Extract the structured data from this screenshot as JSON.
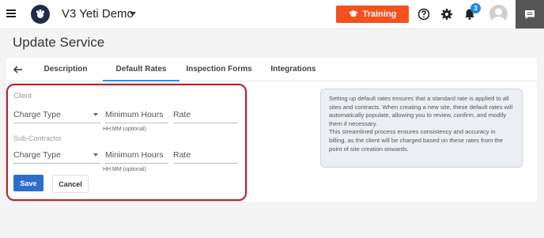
{
  "header": {
    "app_title": "V3 Yeti Demo",
    "training_label": "Training",
    "notification_count": "3",
    "icons": {
      "menu": "hamburger-menu-icon",
      "logo": "logo-icon",
      "training": "graduation-cap-icon",
      "help": "help-icon",
      "settings": "gear-icon",
      "notifications": "bell-icon",
      "avatar": "user-avatar",
      "chat": "chat-icon"
    },
    "colors": {
      "training": "#f4511e",
      "badge": "#1e88e5",
      "chat": "#555555"
    }
  },
  "page": {
    "title": "Update Service"
  },
  "tabs": {
    "items": [
      {
        "label": "Description"
      },
      {
        "label": "Default Rates"
      },
      {
        "label": "Inspection Forms"
      },
      {
        "label": "Integrations"
      }
    ],
    "active": "Default Rates"
  },
  "form": {
    "client_label": "Client",
    "subcontractor_label": "Sub-Contractor",
    "client_row": {
      "charge_type": "Charge Type",
      "minimum_hours": "Minimum Hours",
      "rate": "Rate",
      "hint": "HH:MM (optional)"
    },
    "subcontractor_row": {
      "charge_type": "Charge Type",
      "minimum_hours": "Minimum Hours",
      "rate": "Rate",
      "hint": "HH:MM (optional)"
    },
    "save_label": "Save",
    "cancel_label": "Cancel",
    "colors": {
      "highlight_border": "#b02a35",
      "save": "#2d6ec9"
    }
  },
  "info": {
    "paragraph1": "Setting up default rates ensures that a standard rate is applied to all sites and contracts. When creating a new site, these default rates will automatically populate, allowing you to review, confirm, and modify them if necessary.",
    "paragraph2": "This streamlined process ensures consistency and accuracy in billing, as the client will be charged based on these rates from the point of site creation onwards."
  }
}
